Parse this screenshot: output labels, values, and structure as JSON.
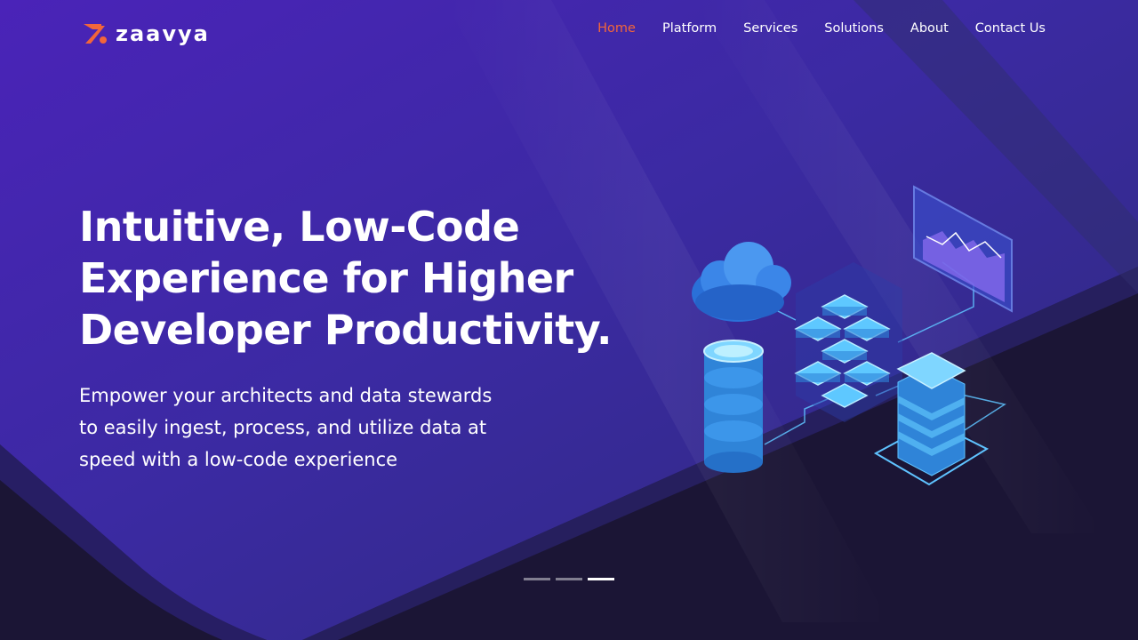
{
  "brand": {
    "name": "zaavya",
    "accent_color": "#f2663a",
    "icon": "zaavya-logo-icon"
  },
  "nav": {
    "items": [
      {
        "label": "Home",
        "active": true
      },
      {
        "label": "Platform",
        "active": false
      },
      {
        "label": "Services",
        "active": false
      },
      {
        "label": "Solutions",
        "active": false
      },
      {
        "label": "About",
        "active": false
      },
      {
        "label": "Contact Us",
        "active": false
      }
    ],
    "active_color": "#f2663a"
  },
  "hero": {
    "headline_lines": [
      "Intuitive, Low-Code",
      "Experience for Higher",
      "Developer Productivity."
    ],
    "subtext_lines": [
      "Empower your architects and data stewards",
      "to easily ingest, process, and utilize data at",
      "speed with a low-code experience"
    ],
    "illustration": "data-infrastructure-illustration"
  },
  "carousel": {
    "slide_count": 3,
    "active_index": 2
  },
  "colors": {
    "background_dark": "#1b1535",
    "hero_purple": "#3d2aa8",
    "text": "#ffffff"
  }
}
